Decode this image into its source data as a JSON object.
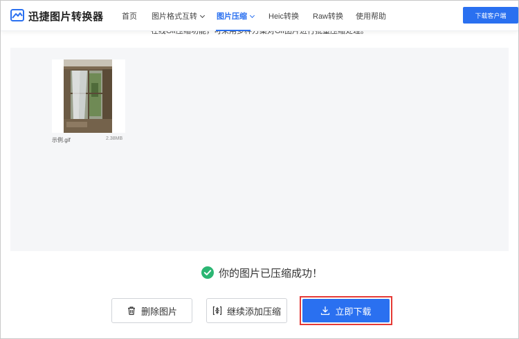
{
  "app": {
    "logo_icon": "landscape-image-icon",
    "title": "迅捷图片转换器"
  },
  "nav": {
    "items": [
      {
        "label": "首页",
        "dropdown": false
      },
      {
        "label": "图片格式互转",
        "dropdown": true
      },
      {
        "label": "图片压缩",
        "dropdown": true,
        "active": true
      },
      {
        "label": "Heic转换",
        "dropdown": false
      },
      {
        "label": "Raw转换",
        "dropdown": false
      },
      {
        "label": "使用帮助",
        "dropdown": false
      }
    ],
    "download_client_label": "下载客户端"
  },
  "intro_text": "在线Gif压缩功能，可采用多种方案对Gif图片进行批量压缩处理。",
  "file": {
    "name": "示例.gif",
    "size": "2.38MB"
  },
  "status": {
    "icon": "check-circle-icon",
    "message": "你的图片已压缩成功！"
  },
  "actions": {
    "delete_label": "删除图片",
    "delete_icon": "trash-icon",
    "add_label": "继续添加压缩",
    "add_icon": "compress-add-icon",
    "download_label": "立即下载",
    "download_icon": "download-icon"
  },
  "colors": {
    "accent": "#2a70f0",
    "success": "#2bb673",
    "highlight_border": "#e53935",
    "work_area_bg": "#f5f6f8"
  }
}
